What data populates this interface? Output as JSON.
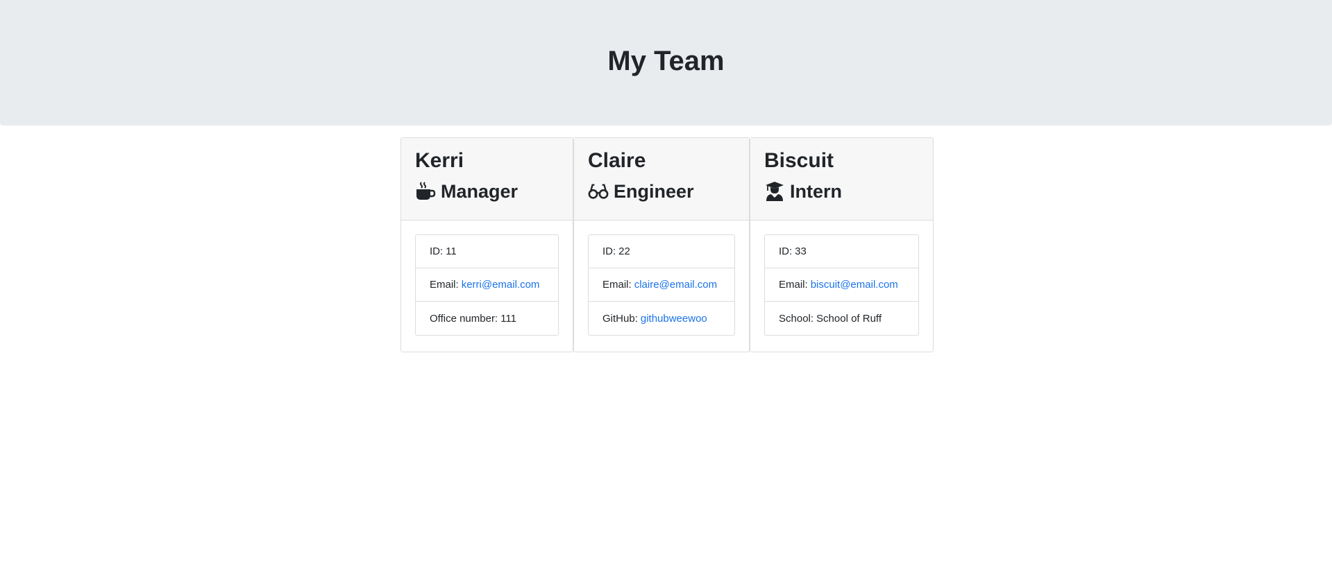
{
  "header": {
    "title": "My Team"
  },
  "colors": {
    "jumbotron_bg": "#e9ecef",
    "link": "#1a73e8",
    "card_header_bg": "#f7f7f7"
  },
  "team": [
    {
      "name": "Kerri",
      "role": "Manager",
      "icon": "mug-hot-icon",
      "id_label": "ID:",
      "id": "11",
      "email_label": "Email:",
      "email": "kerri@email.com",
      "extra_label": "Office number:",
      "extra": "111"
    },
    {
      "name": "Claire",
      "role": "Engineer",
      "icon": "glasses-icon",
      "id_label": "ID:",
      "id": "22",
      "email_label": "Email:",
      "email": "claire@email.com",
      "extra_label": "GitHub:",
      "extra": "githubweewoo"
    },
    {
      "name": "Biscuit",
      "role": "Intern",
      "icon": "graduate-icon",
      "id_label": "ID:",
      "id": "33",
      "email_label": "Email:",
      "email": "biscuit@email.com",
      "extra_label": "School:",
      "extra": "School of Ruff"
    }
  ]
}
